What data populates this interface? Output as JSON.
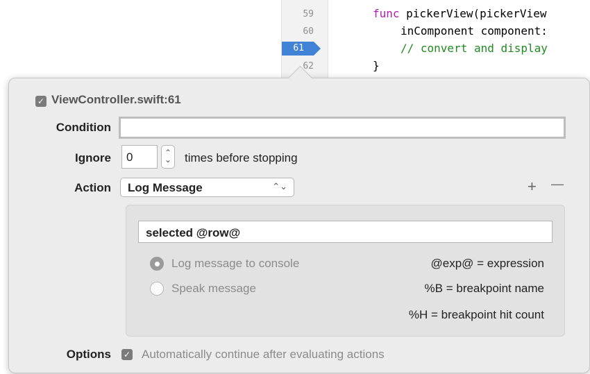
{
  "editor": {
    "line_numbers": [
      "59",
      "60",
      "61",
      "62"
    ],
    "code": {
      "line1_keyword": "func",
      "line1_rest": " pickerView(pickerView",
      "line2": "inComponent component:",
      "line3": "// convert and display",
      "line4": "}"
    }
  },
  "breakpoint": {
    "title": "ViewController.swift:61",
    "enabled": true
  },
  "condition": {
    "label": "Condition",
    "value": ""
  },
  "ignore": {
    "label": "Ignore",
    "value": "0",
    "suffix": "times before stopping"
  },
  "action": {
    "label": "Action",
    "selected": "Log Message",
    "add_label": "+",
    "remove_label": "—",
    "message": "selected @row@",
    "radio_options": [
      {
        "label": "Log message to console",
        "selected": true
      },
      {
        "label": "Speak message",
        "selected": false
      }
    ],
    "hints": [
      "@exp@ = expression",
      "%B = breakpoint name",
      "%H = breakpoint hit count"
    ]
  },
  "options": {
    "label": "Options",
    "checkbox_label": "Automatically continue after evaluating actions",
    "checked": true
  },
  "colors": {
    "breakpoint_blue": "#3f82d6",
    "keyword": "#b21caf",
    "comment": "#208b20"
  }
}
